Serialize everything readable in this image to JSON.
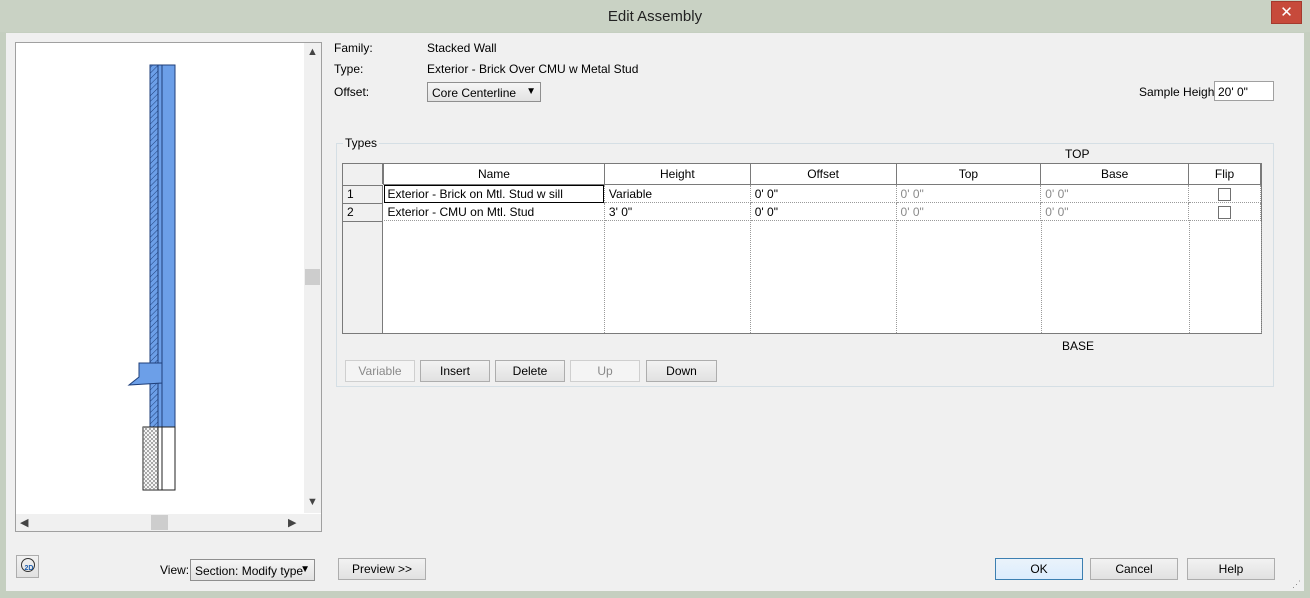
{
  "window": {
    "title": "Edit Assembly",
    "close_glyph": "✕"
  },
  "header": {
    "family_label": "Family:",
    "family_value": "Stacked Wall",
    "type_label": "Type:",
    "type_value": "Exterior - Brick Over CMU w Metal Stud",
    "offset_label": "Offset:",
    "offset_value": "Core Centerline",
    "sample_height_label": "Sample Height:",
    "sample_height_value": "20'  0\""
  },
  "types": {
    "group_label": "Types",
    "top_label": "TOP",
    "base_label": "BASE",
    "columns": [
      "Name",
      "Height",
      "Offset",
      "Top",
      "Base",
      "Flip"
    ],
    "rows": [
      {
        "num": "1",
        "name": "Exterior - Brick on Mtl. Stud w sill",
        "height": "Variable",
        "offset": "0'  0\"",
        "top": "0'  0\"",
        "base": "0'  0\"",
        "flip": false
      },
      {
        "num": "2",
        "name": "Exterior - CMU on Mtl. Stud",
        "height": "3'  0\"",
        "offset": "0'  0\"",
        "top": "0'  0\"",
        "base": "0'  0\"",
        "flip": false
      }
    ]
  },
  "actions": {
    "variable": "Variable",
    "insert": "Insert",
    "delete": "Delete",
    "up": "Up",
    "down": "Down"
  },
  "footer": {
    "view_label": "View:",
    "view_value": "Section: Modify type",
    "preview_button": "Preview >>",
    "ok": "OK",
    "cancel": "Cancel",
    "help": "Help",
    "toggle_2d_badge": "2D"
  },
  "colors": {
    "wall_blue": "#6c9fe8",
    "wall_outline": "#1f3f7a",
    "primary_border": "#3c7fb1"
  },
  "icons": {
    "scroll_up": "▲",
    "scroll_down": "▼",
    "scroll_left": "◀",
    "scroll_right": "▶",
    "dropdown": "▼"
  }
}
